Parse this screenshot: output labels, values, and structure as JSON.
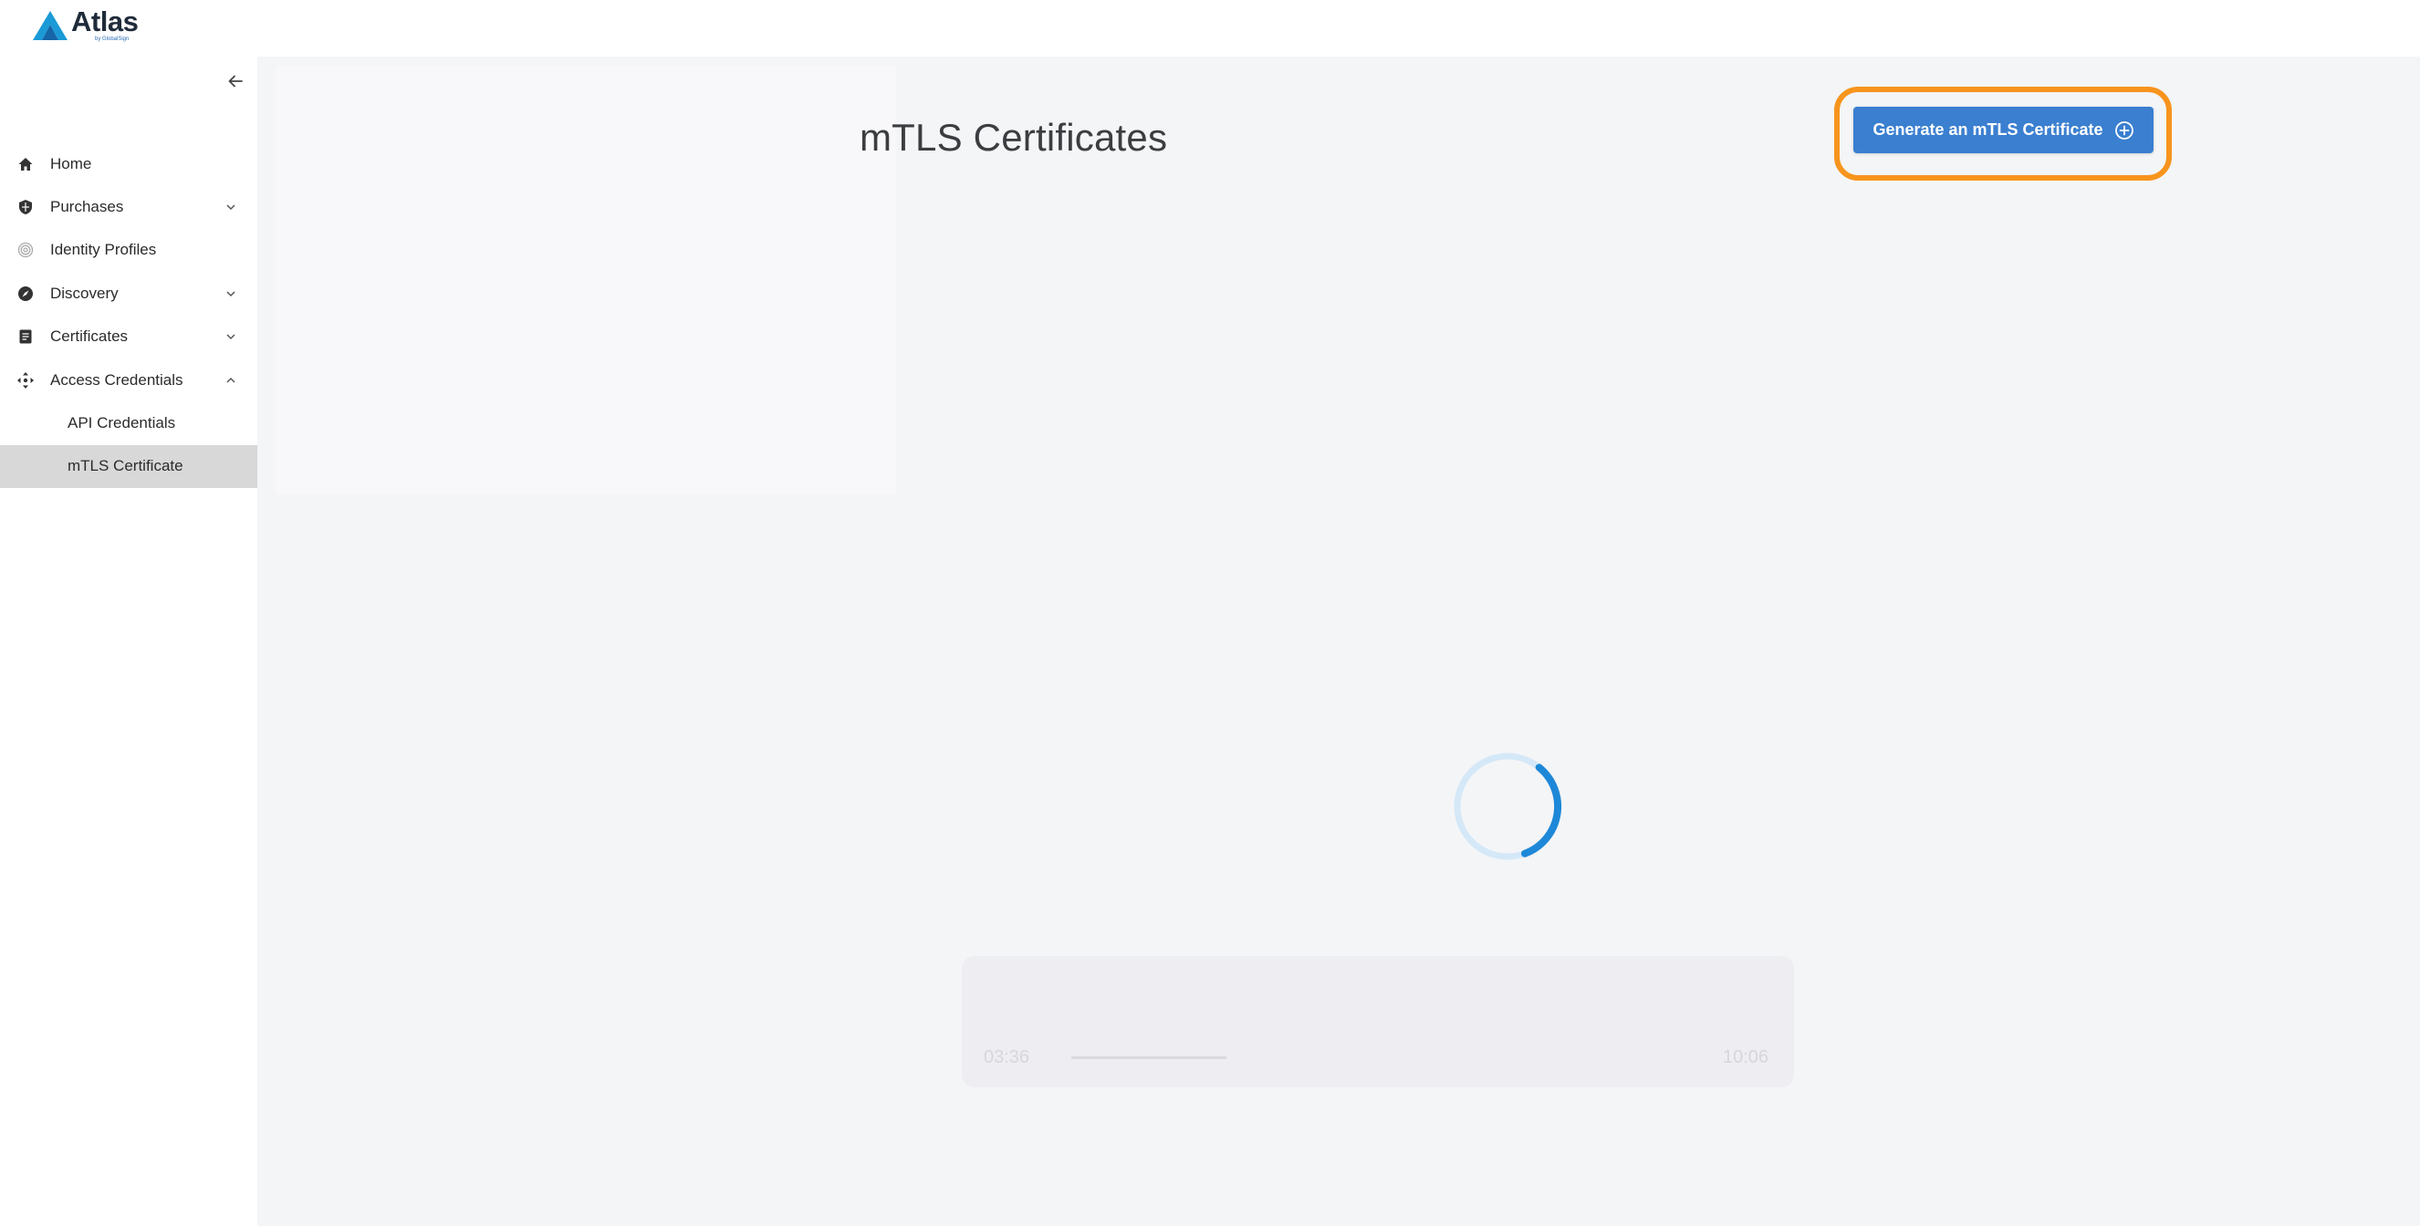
{
  "app": {
    "logo_text": "Atlas",
    "logo_sub": "by GlobalSign",
    "brand_color": "#1a9ad6"
  },
  "sidebar": {
    "collapse_icon": "arrow-left-icon",
    "items": [
      {
        "label": "Home",
        "icon": "home-icon"
      },
      {
        "label": "Purchases",
        "icon": "shield-icon",
        "chevron": "chevron-down-icon"
      },
      {
        "label": "Identity Profiles",
        "icon": "fingerprint-icon"
      },
      {
        "label": "Discovery",
        "icon": "compass-icon",
        "chevron": "chevron-down-icon"
      },
      {
        "label": "Certificates",
        "icon": "document-icon",
        "chevron": "chevron-down-icon"
      },
      {
        "label": "Access Credentials",
        "icon": "move-icon",
        "chevron": "chevron-up-icon",
        "expanded": true
      },
      {
        "label": "API Credentials",
        "sub": true
      },
      {
        "label": "mTLS Certificate",
        "sub": true,
        "active": true
      }
    ]
  },
  "main": {
    "title": "mTLS Certificates",
    "generate_button": "Generate an mTLS Certificate",
    "generate_icon": "plus-circle-icon",
    "highlight_color": "#f7941d",
    "button_color": "#3a7fd0",
    "loading_icon": "loading-spinner-icon"
  },
  "video_overlay": {
    "time_current": "03:36",
    "time_total": "10:06"
  }
}
